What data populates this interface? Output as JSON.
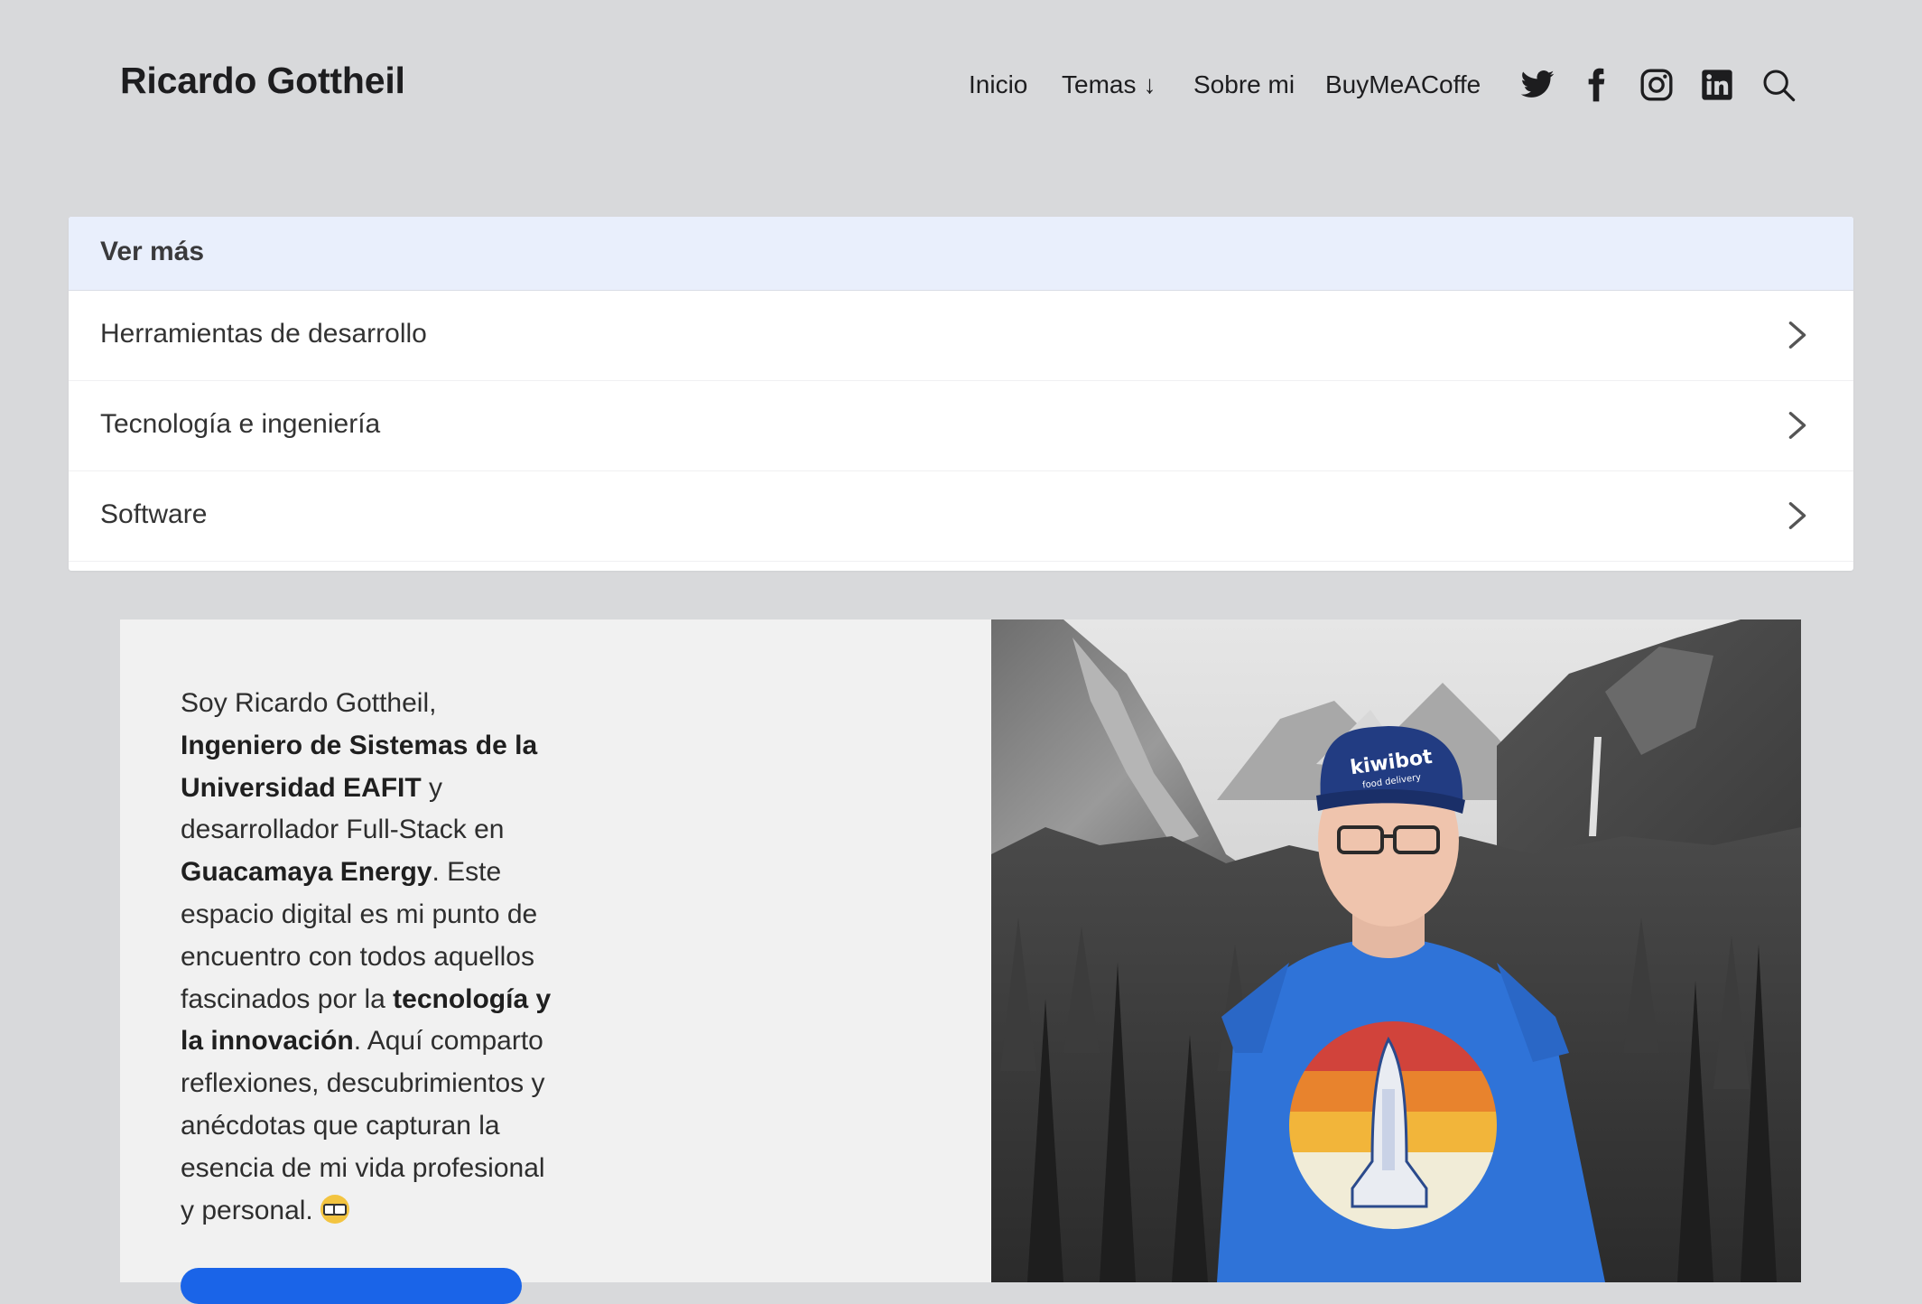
{
  "header": {
    "site_title": "Ricardo Gottheil",
    "nav": [
      {
        "label": "Inicio"
      },
      {
        "label": "Temas",
        "arrow": "↓"
      },
      {
        "label": "Sobre mi"
      },
      {
        "label": "BuyMeACoffe"
      }
    ],
    "social_icons": [
      "twitter-icon",
      "facebook-icon",
      "instagram-icon",
      "linkedin-icon",
      "search-icon"
    ]
  },
  "ver_mas": {
    "header": "Ver más",
    "items": [
      {
        "label": "Herramientas de desarrollo"
      },
      {
        "label": "Tecnología e ingeniería"
      },
      {
        "label": "Software"
      }
    ]
  },
  "intro": {
    "t1": "Soy Ricardo Gottheil, ",
    "b1": "Ingeniero de Sistemas de la Universidad EAFIT",
    "t2": " y desarrollador Full-Stack en ",
    "b2": "Guacamaya Energy",
    "t3": ". Este espacio digital es mi punto de encuentro con todos aquellos fascinados por la ",
    "b3": "tecnología y la innovación",
    "t4": ". Aquí comparto reflexiones, descubrimientos y anécdotas que capturan la esencia de mi vida profesional y personal. ",
    "emoji": "nerd-face-emoji"
  },
  "photo": {
    "cap_text": "kiwibot",
    "cap_subtext": "food delivery"
  },
  "colors": {
    "page_bg": "#d8d9db",
    "card_header_bg": "#e9effc",
    "intro_bg": "#f1f1f1",
    "accent_blue": "#1a64e8"
  }
}
